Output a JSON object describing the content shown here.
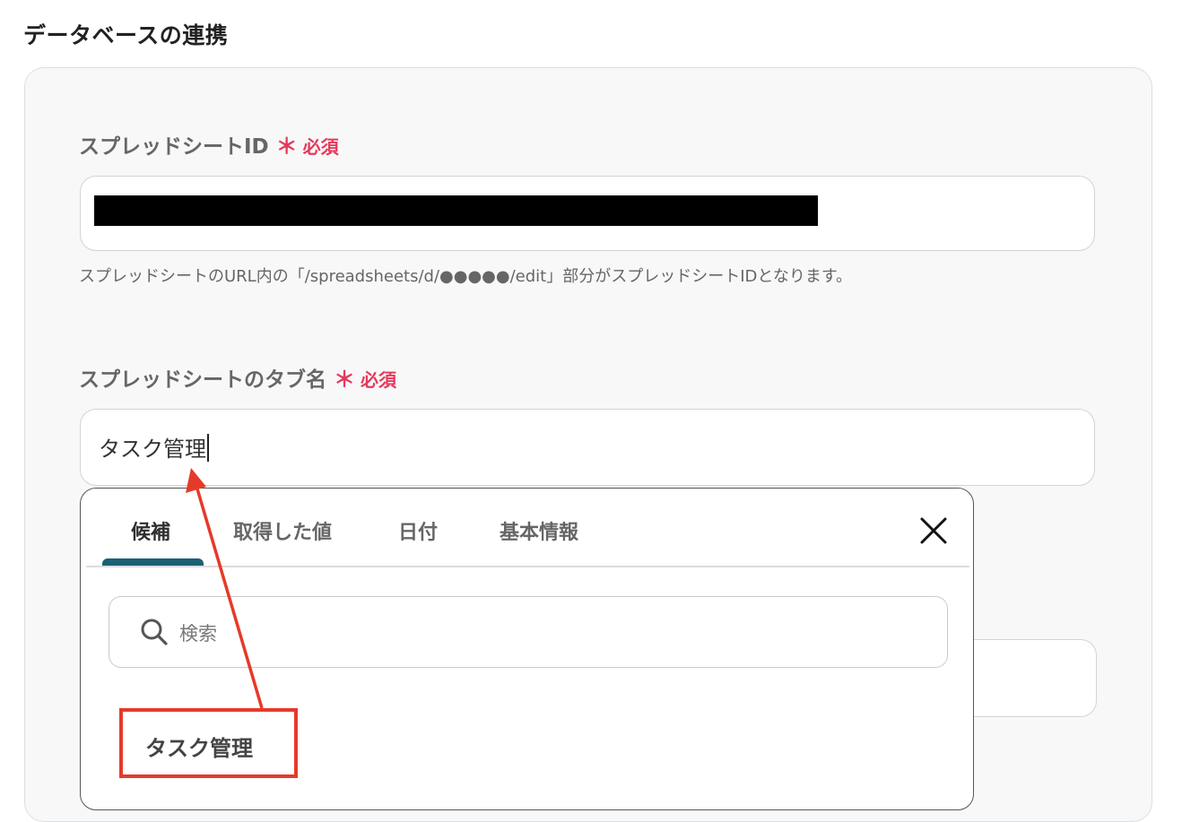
{
  "section": {
    "title": "データベースの連携"
  },
  "fields": [
    {
      "label": "スプレッドシートID",
      "required_mark": "＊",
      "required_text": "必須",
      "value": "",
      "hint": "スプレッドシートのURL内の「/spreadsheets/d/●●●●●/edit」部分がスプレッドシートIDとなります。"
    },
    {
      "label": "スプレッドシートのタブ名",
      "required_mark": "＊",
      "required_text": "必須",
      "value": "タスク管理"
    }
  ],
  "dropdown": {
    "tabs": [
      {
        "label": "候補",
        "active": true
      },
      {
        "label": "取得した値",
        "active": false
      },
      {
        "label": "日付",
        "active": false
      },
      {
        "label": "基本情報",
        "active": false
      }
    ],
    "close_icon": "close-icon",
    "search": {
      "icon": "search-icon",
      "placeholder": "検索",
      "value": ""
    },
    "options": [
      {
        "label": "タスク管理"
      }
    ]
  },
  "annotation": {
    "highlight_color": "#e53a2a"
  },
  "colors": {
    "required": "#e5395b",
    "active_tab_indicator": "#1d5f74"
  }
}
